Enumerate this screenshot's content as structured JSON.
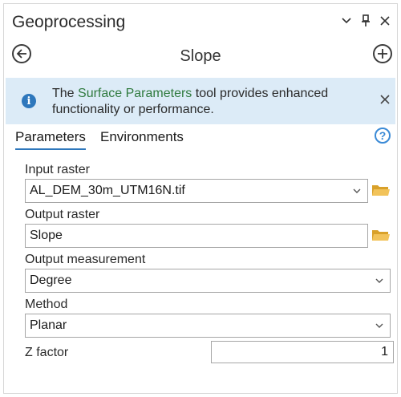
{
  "pane": {
    "title": "Geoprocessing",
    "icons": [
      "chevron-down-icon",
      "pin-icon",
      "close-icon"
    ]
  },
  "tool": {
    "name": "Slope",
    "back_icon": "back-arrow-icon",
    "add_icon": "add-icon"
  },
  "banner": {
    "text_prefix": "The ",
    "link_text": "Surface Parameters",
    "text_suffix": " tool provides enhanced functionality or performance.",
    "icon": "info-icon",
    "close_icon": "close-icon"
  },
  "tabs": [
    {
      "label": "Parameters",
      "active": true
    },
    {
      "label": "Environments",
      "active": false
    }
  ],
  "help_glyph": "?",
  "parameters": {
    "input_raster": {
      "label": "Input raster",
      "value": "AL_DEM_30m_UTM16N.tif"
    },
    "output_raster": {
      "label": "Output raster",
      "value": "Slope"
    },
    "output_measurement": {
      "label": "Output measurement",
      "value": "Degree"
    },
    "method": {
      "label": "Method",
      "value": "Planar"
    },
    "z_factor": {
      "label": "Z factor",
      "value": "1"
    }
  },
  "colors": {
    "accent": "#2e77bc",
    "banner_bg": "#dcebf7",
    "link": "#2f7a3e",
    "folder": "#e8b43c"
  }
}
